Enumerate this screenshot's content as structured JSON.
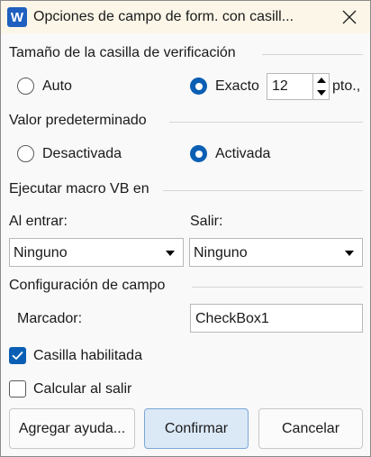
{
  "window": {
    "app_icon_letter": "W",
    "title": "Opciones de campo de form. con casill..."
  },
  "size_section": {
    "label": "Tamaño de la casilla de verificación",
    "auto_label": "Auto",
    "exact_label": "Exacto",
    "exact_value": "12",
    "unit": "pto.,",
    "selected": "exacto"
  },
  "default_section": {
    "label": "Valor predeterminado",
    "off_label": "Desactivada",
    "on_label": "Activada",
    "selected": "activada"
  },
  "macro_section": {
    "label": "Ejecutar macro VB en",
    "entry_label": "Al entrar:",
    "entry_value": "Ninguno",
    "exit_label": "Salir:",
    "exit_value": "Ninguno"
  },
  "field_section": {
    "label": "Configuración de campo",
    "bookmark_label": "Marcador:",
    "bookmark_value": "CheckBox1",
    "enabled_label": "Casilla habilitada",
    "enabled_checked": true,
    "calc_label": "Calcular al salir",
    "calc_checked": false
  },
  "buttons": {
    "help": "Agregar ayuda...",
    "confirm": "Confirmar",
    "cancel": "Cancelar"
  },
  "colors": {
    "accent": "#0a5fb4",
    "titlebar": "#fbf6e8",
    "primary_button": "#dbe9f7"
  }
}
